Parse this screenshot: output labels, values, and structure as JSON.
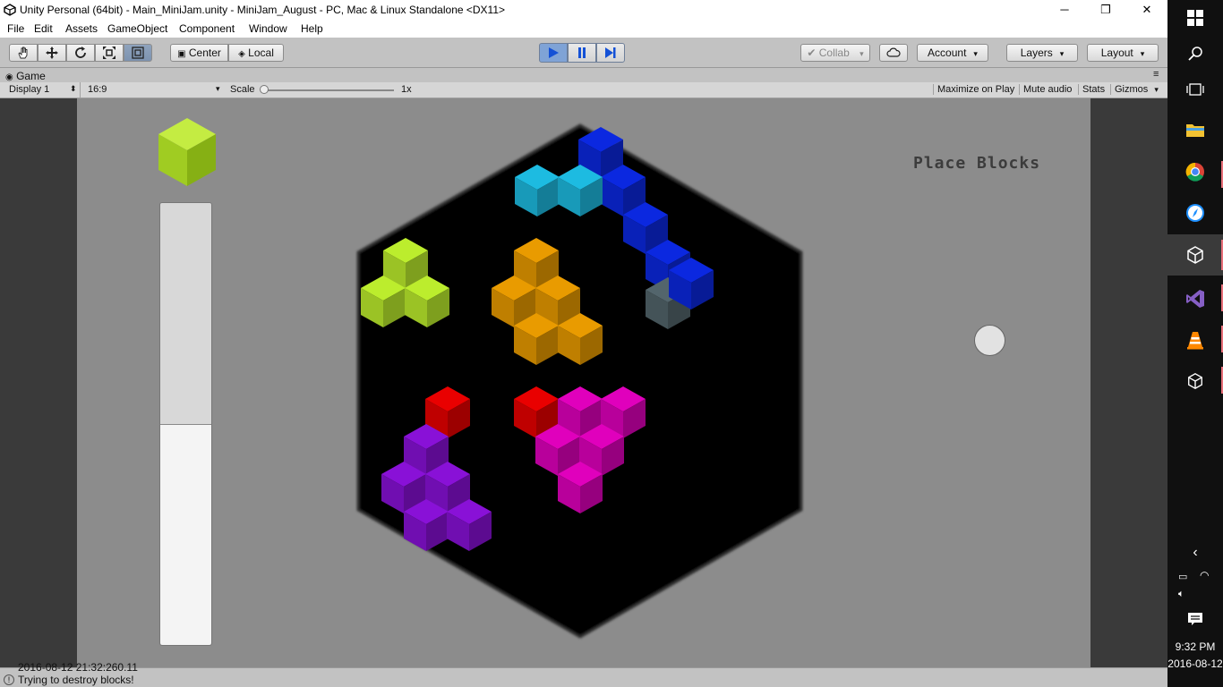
{
  "window": {
    "title": "Unity Personal (64bit) - Main_MiniJam.unity - MiniJam_August - PC, Mac & Linux Standalone <DX11>",
    "minimize": "─",
    "maximize": "❐",
    "close": "✕"
  },
  "menu": [
    "File",
    "Edit",
    "Assets",
    "GameObject",
    "Component",
    "Window",
    "Help"
  ],
  "toolbar": {
    "pivot_label": "Center",
    "space_label": "Local",
    "collab_label": "Collab",
    "account_label": "Account",
    "layers_label": "Layers",
    "layout_label": "Layout"
  },
  "game_panel": {
    "tab_label": "Game",
    "display": "Display 1",
    "aspect": "16:9",
    "scale_label": "Scale",
    "scale_value": "1x",
    "maximize_on_play": "Maximize on Play",
    "mute_audio": "Mute audio",
    "stats": "Stats",
    "gizmos": "Gizmos"
  },
  "game": {
    "status_text": "Place Blocks",
    "next_block_color": "#a8d428",
    "progress_fill": 0.5
  },
  "status": {
    "timestamp": "2016-08-12 21:32:260.11",
    "message": "Trying to destroy blocks!"
  },
  "taskbar": {
    "time": "9:32 PM",
    "date": "2016-08-12"
  },
  "colors": {
    "cyan": "#1aa7c9",
    "blue": "#0a24c8",
    "lime": "#a8d428",
    "orange": "#d08a00",
    "red": "#d00000",
    "magenta": "#c800a8",
    "purple": "#7a0fc0",
    "gray": "#4a5a60"
  }
}
